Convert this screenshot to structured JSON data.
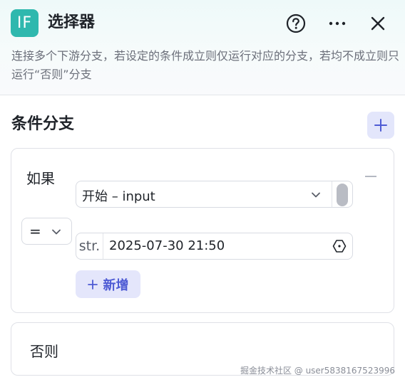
{
  "header": {
    "icon_text": "IF",
    "title": "选择器",
    "description": "连接多个下游分支，若设定的条件成立则仅运行对应的分支，若均不成立则只运行“否则”分支",
    "icons": [
      "help-icon",
      "more-icon",
      "close-icon"
    ]
  },
  "section": {
    "title": "条件分支"
  },
  "if_card": {
    "label": "如果",
    "operator": "=",
    "variable": "开始 – input",
    "value_type": "str.",
    "value": "2025-07-30 21:50",
    "add_label": "新增"
  },
  "else_card": {
    "label": "否则"
  },
  "watermark": "掘金技术社区 @ user5838167523996",
  "colors": {
    "brand_teal": "#2fb8ae",
    "accent_indigo": "#4e5bd4",
    "accent_bg": "#e4e6fb"
  }
}
